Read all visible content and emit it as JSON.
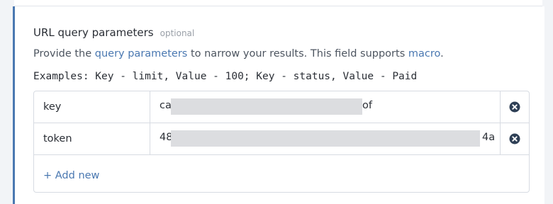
{
  "section": {
    "title": "URL query parameters",
    "optional_label": "optional",
    "description_prefix": "Provide the ",
    "description_link_query": "query parameters",
    "description_middle": " to narrow your results. This field supports ",
    "description_link_macro": "macro",
    "description_suffix": ".",
    "examples": "Examples: Key - limit, Value - 100; Key - status, Value - Paid"
  },
  "params": [
    {
      "key": "key",
      "value_start": "ca",
      "value_end": "of",
      "value_redacted": true
    },
    {
      "key": "token",
      "value_start": "48",
      "value_end": "4a",
      "value_redacted": true
    }
  ],
  "add_new_label": "+ Add new",
  "colors": {
    "accent": "#4a78b1",
    "delete_icon": "#2e3f55",
    "border": "#d7dbe2",
    "redaction": "#dcdde0"
  },
  "icons": {
    "delete": "close-circle-icon"
  }
}
